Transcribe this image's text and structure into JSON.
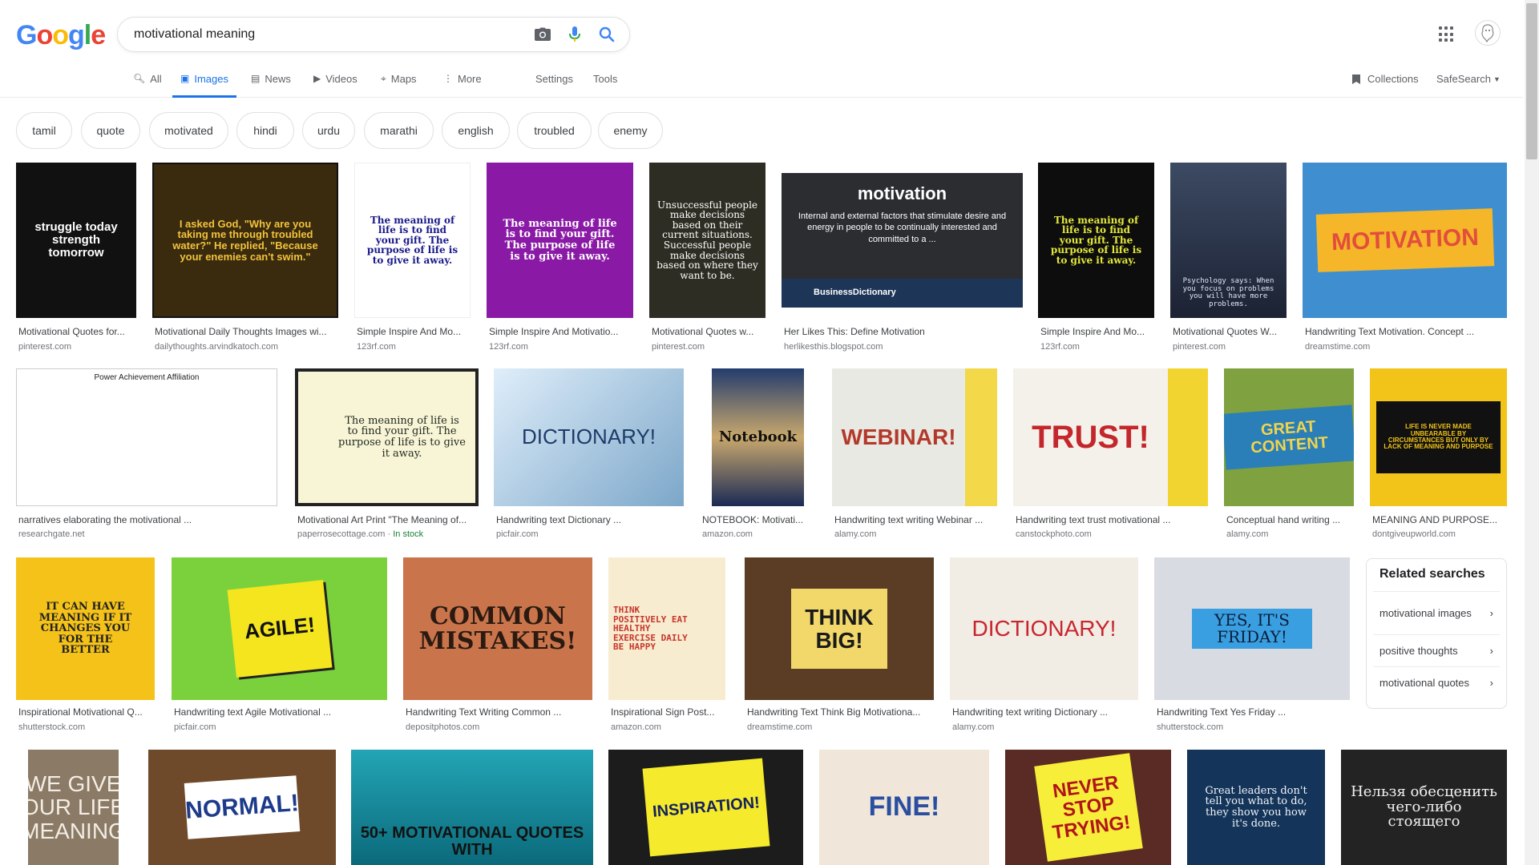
{
  "logo": {
    "letters": [
      "G",
      "o",
      "o",
      "g",
      "l",
      "e"
    ]
  },
  "search": {
    "value": "motivational meaning"
  },
  "tabs": {
    "all": "All",
    "images": "Images",
    "news": "News",
    "videos": "Videos",
    "maps": "Maps",
    "more": "More",
    "settings": "Settings",
    "tools": "Tools"
  },
  "right_tabs": {
    "collections": "Collections",
    "safesearch": "SafeSearch"
  },
  "chips": [
    "tamil",
    "quote",
    "motivated",
    "hindi",
    "urdu",
    "marathi",
    "english",
    "troubled",
    "enemy"
  ],
  "row1": [
    {
      "caption": "Motivational Quotes for...",
      "source": "pinterest.com",
      "thumb": "struggle today strength tomorrow"
    },
    {
      "caption": "Motivational Daily Thoughts Images wi...",
      "source": "dailythoughts.arvindkatoch.com",
      "thumb": "I asked God, \"Why are you taking me through troubled water?\" He replied, \"Because your enemies can't swim.\""
    },
    {
      "caption": "Simple Inspire And Mo...",
      "source": "123rf.com",
      "thumb": "The meaning of life is to find your gift. The purpose of life is to give it away."
    },
    {
      "caption": "Simple Inspire And Motivatio...",
      "source": "123rf.com",
      "thumb": "The meaning of life is to find your gift. The purpose of life is to give it away."
    },
    {
      "caption": "Motivational Quotes w...",
      "source": "pinterest.com",
      "thumb": "Unsuccessful people make decisions based on their current situations. Successful people make decisions based on where they want to be."
    },
    {
      "caption": "Her Likes This: Define Motivation",
      "source": "herlikesthis.blogspot.com",
      "thumb": "motivation",
      "sub": "Internal and external factors that stimulate desire and energy in people to be continually interested and committed to a ...",
      "brand": "BusinessDictionary"
    },
    {
      "caption": "Simple Inspire And Mo...",
      "source": "123rf.com",
      "thumb": "The meaning of life is to find your gift. The purpose of life is to give it away."
    },
    {
      "caption": "Motivational Quotes W...",
      "source": "pinterest.com",
      "thumb": "Psychology says: When you focus on problems you will have more problems."
    },
    {
      "caption": "Handwriting Text Motivation. Concept ...",
      "source": "dreamstime.com",
      "thumb": "MOTIVATION"
    }
  ],
  "row2": [
    {
      "caption": "narratives elaborating the motivational ...",
      "source": "researchgate.net",
      "thumb": "Power  Achievement  Affiliation"
    },
    {
      "caption": "Motivational Art Print \"The Meaning of...",
      "source": "paperrosecottage.com",
      "stock": "In stock",
      "thumb": "The meaning of life is to find your gift. The purpose of life is to give it away."
    },
    {
      "caption": "Handwriting text Dictionary ...",
      "source": "picfair.com",
      "thumb": "DICTIONARY!"
    },
    {
      "caption": "NOTEBOOK: Motivati...",
      "source": "amazon.com",
      "thumb": "Notebook"
    },
    {
      "caption": "Handwriting text writing Webinar ...",
      "source": "alamy.com",
      "thumb": "WEBINAR!"
    },
    {
      "caption": "Handwriting text trust motivational ...",
      "source": "canstockphoto.com",
      "thumb": "TRUST!"
    },
    {
      "caption": "Conceptual hand writing ...",
      "source": "alamy.com",
      "thumb": "GREAT CONTENT"
    },
    {
      "caption": "MEANING AND PURPOSE...",
      "source": "dontgiveupworld.com",
      "thumb": "LIFE IS NEVER MADE UNBEARABLE BY CIRCUMSTANCES BUT ONLY BY LACK OF MEANING AND PURPOSE"
    }
  ],
  "row3": [
    {
      "caption": "Inspirational Motivational Q...",
      "source": "shutterstock.com",
      "thumb": "IT CAN HAVE MEANING IF IT CHANGES YOU FOR THE BETTER"
    },
    {
      "caption": "Handwriting text Agile Motivational ...",
      "source": "picfair.com",
      "thumb": "AGILE!"
    },
    {
      "caption": "Handwriting Text Writing Common ...",
      "source": "depositphotos.com",
      "thumb": "COMMON MISTAKES!"
    },
    {
      "caption": "Inspirational Sign Post...",
      "source": "amazon.com",
      "thumb": "THINK POSITIVELY EAT HEALTHY EXERCISE DAILY BE HAPPY"
    },
    {
      "caption": "Handwriting Text Think Big Motivationa...",
      "source": "dreamstime.com",
      "thumb": "THINK BIG!"
    },
    {
      "caption": "Handwriting text writing Dictionary ...",
      "source": "alamy.com",
      "thumb": "DICTIONARY!"
    },
    {
      "caption": "Handwriting Text Yes Friday ...",
      "source": "shutterstock.com",
      "thumb": "YES, IT'S FRIDAY!"
    }
  ],
  "row4": [
    {
      "thumb": "WE GIVE OUR LIFE MEANING"
    },
    {
      "thumb": "NORMAL!"
    },
    {
      "thumb": "50+ MOTIVATIONAL QUOTES WITH"
    },
    {
      "thumb": "INSPIRATION!"
    },
    {
      "thumb": "FINE!"
    },
    {
      "thumb": "NEVER STOP TRYING!"
    },
    {
      "thumb": "Great leaders don't tell you what to do, they show you how it's done."
    },
    {
      "thumb": "Нельзя обесценить чего-либо стоящего"
    }
  ],
  "related": {
    "title": "Related searches",
    "items": [
      "motivational images",
      "positive thoughts",
      "motivational quotes"
    ]
  }
}
